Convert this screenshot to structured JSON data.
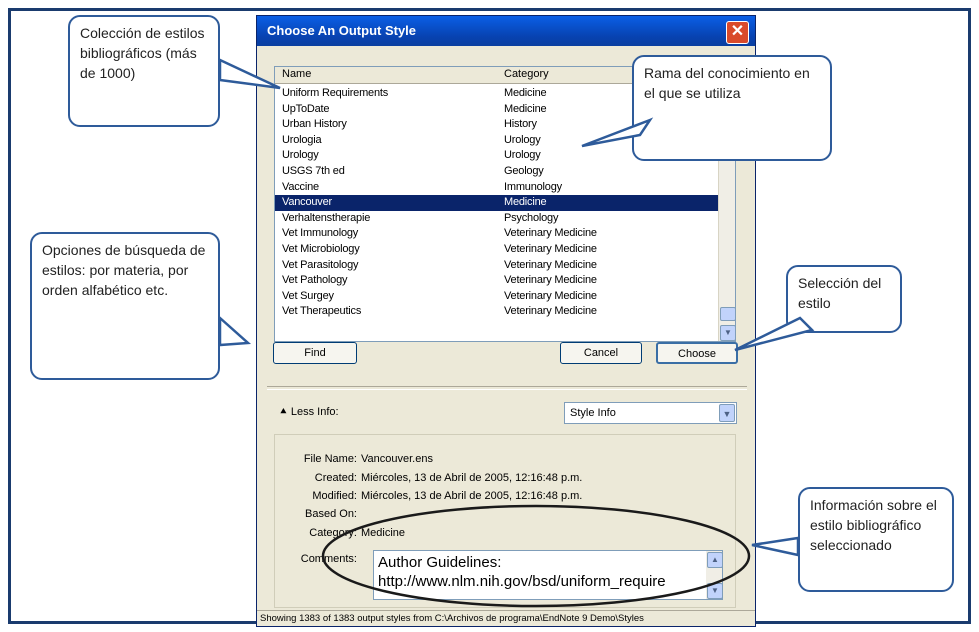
{
  "dialog": {
    "title": "Choose An Output Style",
    "columns": {
      "name": "Name",
      "category": "Category"
    },
    "rows": [
      {
        "name": "Uniform Requirements",
        "category": "Medicine"
      },
      {
        "name": "UpToDate",
        "category": "Medicine"
      },
      {
        "name": "Urban History",
        "category": "History"
      },
      {
        "name": "Urologia",
        "category": "Urology"
      },
      {
        "name": "Urology",
        "category": "Urology"
      },
      {
        "name": "USGS 7th ed",
        "category": "Geology"
      },
      {
        "name": "Vaccine",
        "category": "Immunology"
      },
      {
        "name": "Vancouver",
        "category": "Medicine",
        "selected": true
      },
      {
        "name": "Verhaltenstherapie",
        "category": "Psychology"
      },
      {
        "name": "Vet Immunology",
        "category": "Veterinary Medicine"
      },
      {
        "name": "Vet Microbiology",
        "category": "Veterinary Medicine"
      },
      {
        "name": "Vet Parasitology",
        "category": "Veterinary Medicine"
      },
      {
        "name": "Vet Pathology",
        "category": "Veterinary Medicine"
      },
      {
        "name": "Vet Surgey",
        "category": "Veterinary Medicine"
      },
      {
        "name": "Vet Therapeutics",
        "category": "Veterinary Medicine"
      }
    ],
    "buttons": {
      "find": "Find",
      "cancel": "Cancel",
      "choose": "Choose"
    },
    "less_info": "Less Info:",
    "style_info_select": "Style Info",
    "info": {
      "file_name_label": "File Name:",
      "file_name": "Vancouver.ens",
      "created_label": "Created:",
      "created": "Miércoles, 13 de Abril de 2005, 12:16:48 p.m.",
      "modified_label": "Modified:",
      "modified": "Miércoles, 13 de Abril de 2005, 12:16:48 p.m.",
      "based_on_label": "Based On:",
      "based_on": "",
      "category_label": "Category:",
      "category": "Medicine",
      "comments_label": "Comments:",
      "comments_line1": "Author Guidelines:",
      "comments_line2": "http://www.nlm.nih.gov/bsd/uniform_require"
    },
    "status": "Showing 1383 of 1383 output styles from C:\\Archivos de programa\\EndNote 9 Demo\\Styles"
  },
  "callouts": {
    "collection": "Colección de estilos bibliográficos (más de 1000)",
    "branch": "Rama del conocimiento en el que se utiliza",
    "search": "Opciones de búsqueda de estilos: por materia, por orden alfabético etc.",
    "selection": "Selección del estilo",
    "information": "Información sobre el estilo bibliográfico seleccionado"
  },
  "colors": {
    "selection": "#0a246a",
    "callout_border": "#2e5b9a",
    "title_bar": "#0842b0"
  }
}
